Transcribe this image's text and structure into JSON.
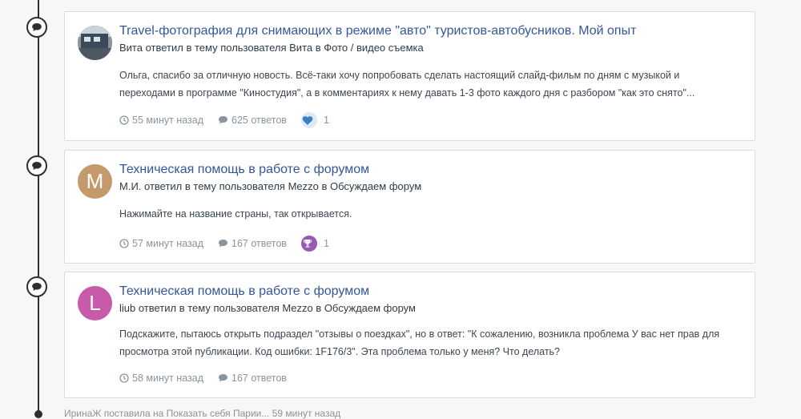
{
  "activity": [
    {
      "title": "Travel-фотография для снимающих в режиме \"авто\" туристов-автобусников. Мой опыт",
      "subtitle": "Вита ответил в тему пользователя Вита в Фото / видео съемка",
      "excerpt": "Ольга, спасибо за отличную новость. Всё-таки хочу попробовать сделать настоящий слайд-фильм по дням с музыкой и переходами в программе \"Киностудия\", а в комментариях к нему давать 1-3 фото каждого дня с разбором \"как это снято\"...",
      "time": "55 минут назад",
      "replies": "625 ответов",
      "reaction_count": "1",
      "reaction_icon": "heart-icon",
      "reaction_color": "#3d7fc4",
      "avatar_letter": "",
      "avatar_color": "#5f6b75"
    },
    {
      "title": "Техническая помощь в работе с форумом",
      "subtitle": "М.И. ответил в тему пользователя Mezzo в Обсуждаем форум",
      "excerpt": "Нажимайте на название страны, так открывается.",
      "time": "57 минут назад",
      "replies": "167 ответов",
      "reaction_count": "1",
      "reaction_icon": "trophy-icon",
      "reaction_color": "#9b59b6",
      "avatar_letter": "M",
      "avatar_color": "#c49a6c"
    },
    {
      "title": "Техническая помощь в работе с форумом",
      "subtitle": "liub ответил в тему пользователя Mezzo в Обсуждаем форум",
      "excerpt": "Подскажите, пытаюсь открыть подраздел \"отзывы о поездках\", но в ответ: \"К сожалению, возникла проблема У вас нет прав для просмотра этой публикации. Код ошибки: 1F176/3\". Эта проблема только у меня? Что делать?",
      "time": "58 минут назад",
      "replies": "167 ответов",
      "avatar_letter": "L",
      "avatar_color": "#c85aaa"
    }
  ],
  "bottom_text": "ИринаЖ поставила на Показать себя Парии...  59 минут назад"
}
